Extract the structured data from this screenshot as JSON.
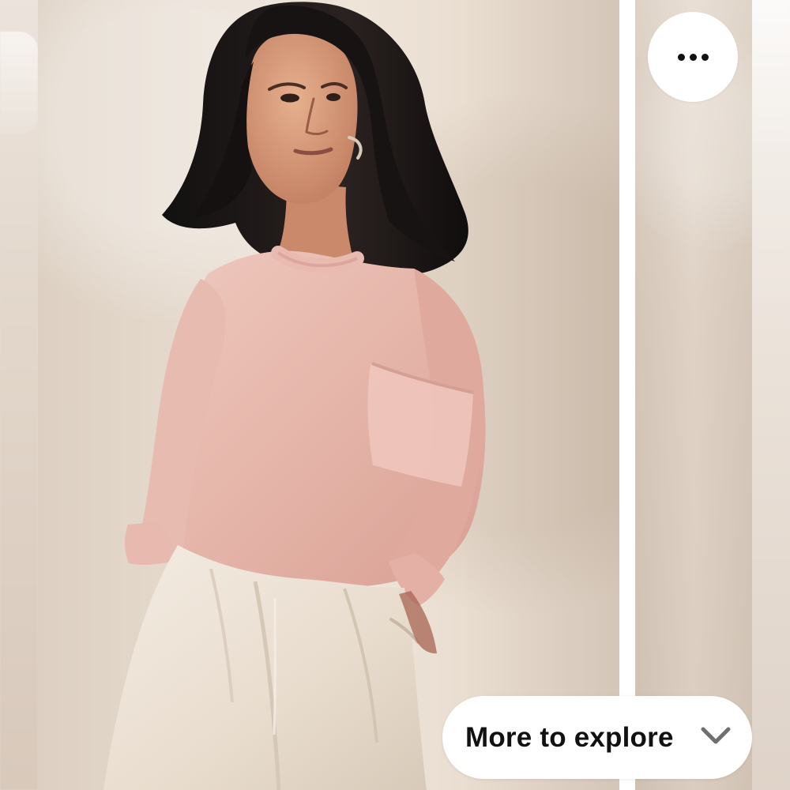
{
  "app": {
    "title": ""
  },
  "overlay": {
    "more_button_icon": "more-horizontal-icon",
    "explore_button_label": "More to explore",
    "explore_button_icon": "chevron-down-icon"
  },
  "colors": {
    "background": "#e7ddd2",
    "overlay_button": "#ffffff",
    "icon": "#111111",
    "sweater": "#e7b8ad",
    "pants": "#eadfd3",
    "hair": "#1b1717",
    "skin": "#d79f82"
  }
}
